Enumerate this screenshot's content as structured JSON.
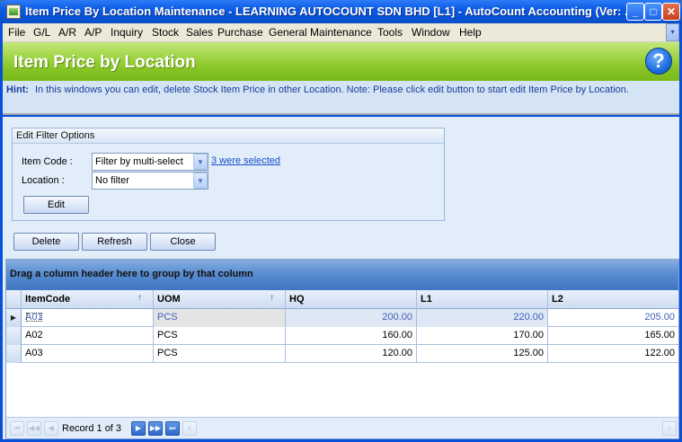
{
  "window": {
    "title": "Item Price By Location Maintenance - LEARNING AUTOCOUNT SDN BHD [L1] - AutoCount Accounting (Ver: ...",
    "minimize_glyph": "_",
    "maximize_glyph": "□",
    "close_glyph": "✕"
  },
  "menu": {
    "items": [
      "File",
      "G/L",
      "A/R",
      "A/P",
      "Inquiry",
      "Stock",
      "Sales",
      "Purchase",
      "General Maintenance",
      "Tools",
      "Window",
      "Help"
    ],
    "scroll_glyph": "▾"
  },
  "header": {
    "title": "Item Price by Location",
    "help_glyph": "?"
  },
  "hint": {
    "label": "Hint:",
    "text": "In this windows you can edit, delete Stock Item Price in other Location. Note: Please click edit button to start edit Item Price by Location."
  },
  "filter": {
    "title": "Edit Filter Options",
    "item_code_label": "Item Code :",
    "item_code_value": "Filter by multi-select",
    "selected_link": "3 were selected",
    "location_label": "Location :",
    "location_value": "No filter",
    "edit_label": "Edit"
  },
  "actions": {
    "delete_label": "Delete",
    "refresh_label": "Refresh",
    "close_label": "Close"
  },
  "grid": {
    "group_hint": "Drag a column header here to group by that column",
    "columns": [
      "ItemCode",
      "UOM",
      "HQ",
      "L1",
      "L2"
    ],
    "sort_glyph": "↑",
    "rows": [
      {
        "item_code": "A01",
        "uom": "PCS",
        "hq": "200.00",
        "l1": "220.00",
        "l2": "205.00"
      },
      {
        "item_code": "A02",
        "uom": "PCS",
        "hq": "160.00",
        "l1": "170.00",
        "l2": "165.00"
      },
      {
        "item_code": "A03",
        "uom": "PCS",
        "hq": "120.00",
        "l1": "125.00",
        "l2": "122.00"
      }
    ],
    "current_row_glyph": "▶"
  },
  "navigator": {
    "record_text": "Record 1 of 3",
    "first_glyph": "⏮",
    "prev_page_glyph": "◀◀",
    "prev_glyph": "◀",
    "next_glyph": "▶",
    "next_page_glyph": "▶▶",
    "last_glyph": "⏭",
    "scroll_left_glyph": "<",
    "scroll_right_glyph": ">"
  }
}
